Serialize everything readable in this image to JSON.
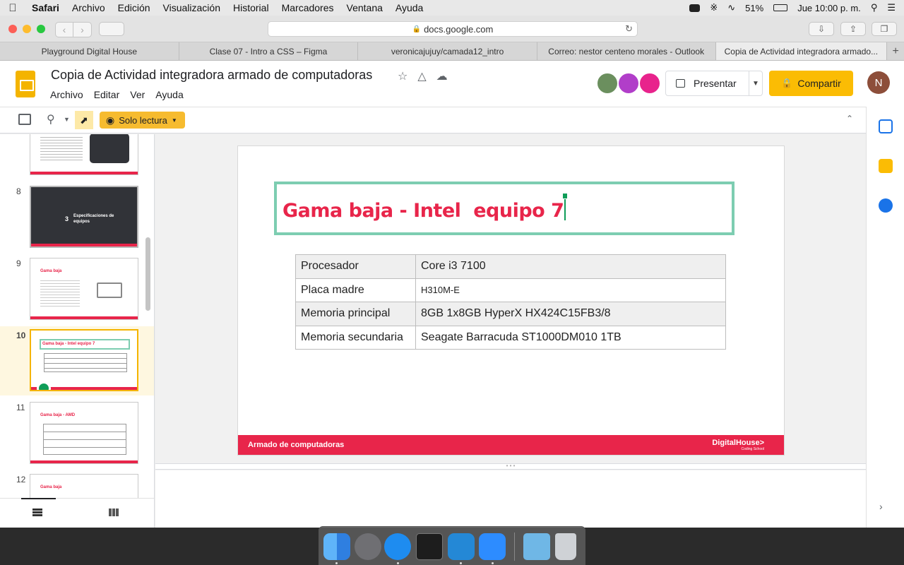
{
  "menubar": {
    "app_name": "Safari",
    "items": [
      "Archivo",
      "Edición",
      "Visualización",
      "Historial",
      "Marcadores",
      "Ventana",
      "Ayuda"
    ],
    "battery": "51%",
    "clock": "Jue 10:00 p. m."
  },
  "browser": {
    "url": "docs.google.com",
    "tabs": [
      "Playground Digital House",
      "Clase 07 - Intro a CSS – Figma",
      "veronicajujuy/camada12_intro",
      "Correo: nestor centeno morales - Outlook",
      "Copia de Actividad integradora armado..."
    ],
    "active_tab": 4
  },
  "doc": {
    "title": "Copia de Actividad integradora armado de computadoras",
    "menus": [
      "Archivo",
      "Editar",
      "Ver",
      "Ayuda"
    ],
    "present_label": "Presentar",
    "share_label": "Compartir",
    "user_initial": "N",
    "mode_label": "Solo lectura"
  },
  "filmstrip": {
    "slides": [
      {
        "num": "8",
        "text": "Especificaciones de equipos",
        "badge": "3"
      },
      {
        "num": "9",
        "text": "Gama baja"
      },
      {
        "num": "10",
        "text": "Gama baja - Intel equipo 7"
      },
      {
        "num": "11",
        "text": "Gama baja - AMD"
      },
      {
        "num": "12",
        "text": "Gama baja"
      }
    ],
    "active": "10"
  },
  "slide": {
    "title": "Gama baja - Intel  equipo 7",
    "rows": [
      {
        "label": "Procesador",
        "value": "Core i3 7100"
      },
      {
        "label": "Placa madre",
        "value": "H310M-E"
      },
      {
        "label": "Memoria principal",
        "value": "8GB 1x8GB HyperX HX424C15FB3/8"
      },
      {
        "label": "Memoria secundaria",
        "value": "Seagate Barracuda ST1000DM010 1TB"
      }
    ],
    "footer_left": "Armado de computadoras",
    "footer_brand": "DigitalHouse>",
    "footer_brand_sub": "Coding School"
  },
  "colors": {
    "accent_red": "#e8254a",
    "title_border": "#7dcdb1",
    "share_yellow": "#fbbc04"
  }
}
